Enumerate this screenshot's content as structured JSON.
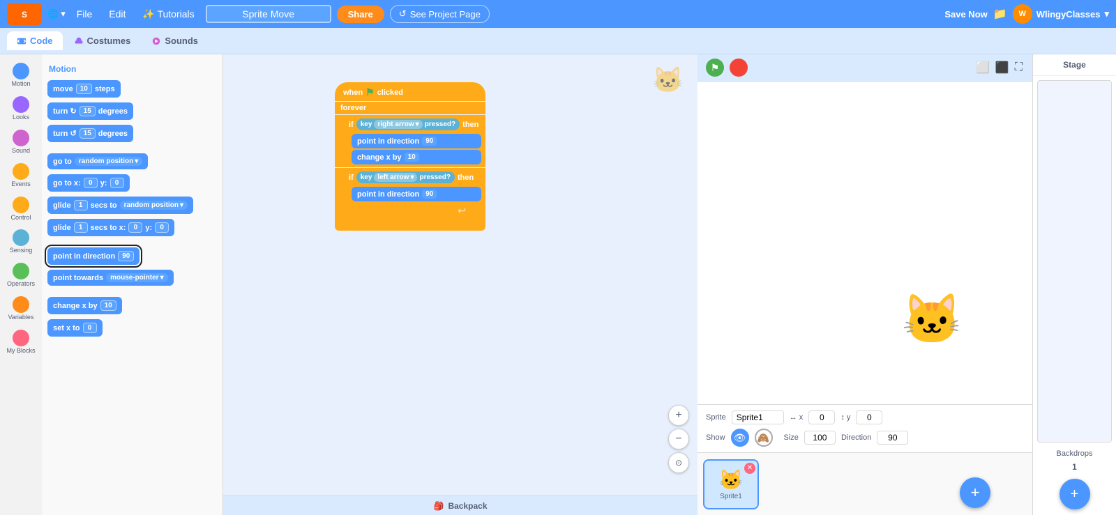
{
  "navbar": {
    "logo_text": "Scratch",
    "globe_label": "🌐",
    "file_label": "File",
    "edit_label": "Edit",
    "tutorials_label": "✨ Tutorials",
    "project_title": "Sprite Move",
    "share_label": "Share",
    "see_project_label": "See Project Page",
    "save_now_label": "Save Now",
    "user_name": "WlingyClasses",
    "chevron": "▾"
  },
  "tabs": {
    "code_label": "Code",
    "costumes_label": "Costumes",
    "sounds_label": "Sounds"
  },
  "categories": [
    {
      "id": "motion",
      "label": "Motion",
      "color": "#4C97FF"
    },
    {
      "id": "looks",
      "label": "Looks",
      "color": "#9966FF"
    },
    {
      "id": "sound",
      "label": "Sound",
      "color": "#CF63CF"
    },
    {
      "id": "events",
      "label": "Events",
      "color": "#FFAB19"
    },
    {
      "id": "control",
      "label": "Control",
      "color": "#FFAB19"
    },
    {
      "id": "sensing",
      "label": "Sensing",
      "color": "#5CB1D6"
    },
    {
      "id": "operators",
      "label": "Operators",
      "color": "#59C059"
    },
    {
      "id": "variables",
      "label": "Variables",
      "color": "#FF8C1A"
    },
    {
      "id": "myblocks",
      "label": "My Blocks",
      "color": "#FF6680"
    }
  ],
  "section_title": "Motion",
  "blocks": [
    {
      "text": "move",
      "value": "10",
      "suffix": "steps"
    },
    {
      "text": "turn ↻",
      "value": "15",
      "suffix": "degrees"
    },
    {
      "text": "turn ↺",
      "value": "15",
      "suffix": "degrees"
    },
    {
      "text": "go to",
      "dropdown": "random position"
    },
    {
      "text": "go to x:",
      "val1": "0",
      "mid": "y:",
      "val2": "0"
    },
    {
      "text": "glide",
      "val1": "1",
      "mid": "secs to",
      "dropdown": "random position"
    },
    {
      "text": "glide",
      "val1": "1",
      "mid": "secs to x:",
      "val2": "0",
      "mid2": "y:",
      "val3": "0"
    },
    {
      "text": "point in direction",
      "value": "90",
      "selected": true
    },
    {
      "text": "point towards",
      "dropdown": "mouse-pointer"
    },
    {
      "text": "change x by",
      "value": "10"
    },
    {
      "text": "set x to",
      "value": "0"
    }
  ],
  "canvas_blocks": {
    "when_clicked": "when 🚩 clicked",
    "forever": "forever",
    "if_right": "if",
    "key_right": "key",
    "right_arrow": "right arrow",
    "pressed": "pressed?",
    "then": "then",
    "point_dir_90_1": "point in direction",
    "val_90_1": "90",
    "change_x_10": "change x by",
    "val_10": "10",
    "if_left": "if",
    "key_left": "key",
    "left_arrow": "left arrow",
    "pressed2": "pressed?",
    "then2": "then",
    "point_dir_90_2": "point in direction",
    "val_90_2": "90"
  },
  "sprite_info": {
    "sprite_label": "Sprite",
    "sprite_name": "Sprite1",
    "x_label": "x",
    "x_val": "0",
    "y_label": "y",
    "y_val": "0",
    "show_label": "Show",
    "size_label": "Size",
    "size_val": "100",
    "direction_label": "Direction",
    "direction_val": "90"
  },
  "stage_panel": {
    "title": "Stage",
    "backdrops_label": "Backdrops",
    "backdrops_count": "1"
  },
  "backpack": {
    "label": "Backpack"
  },
  "zoom_in": "+",
  "zoom_out": "−",
  "zoom_reset": "⊙"
}
